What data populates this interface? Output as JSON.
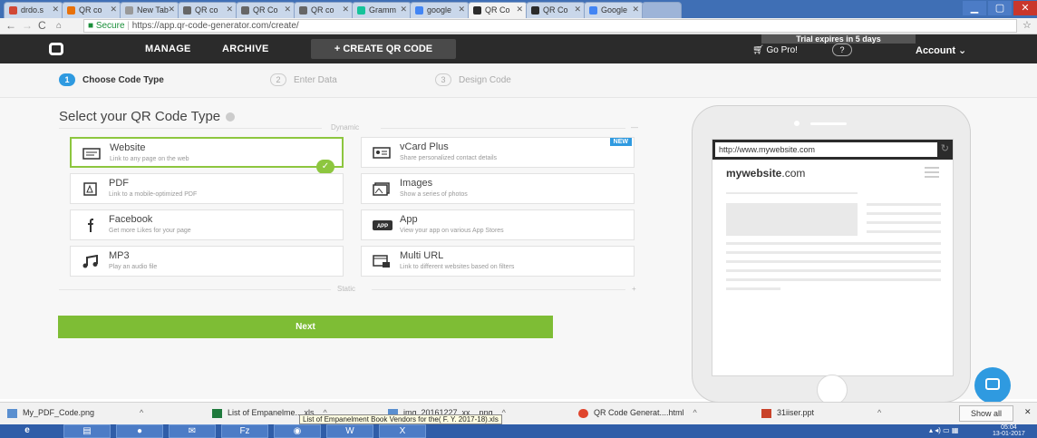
{
  "browser": {
    "tabs": [
      {
        "label": "drdo.s",
        "color": "#d14836"
      },
      {
        "label": "QR co",
        "color": "#e8710a"
      },
      {
        "label": "New Tab",
        "color": "#999999"
      },
      {
        "label": "QR co",
        "color": "#666666"
      },
      {
        "label": "QR Co",
        "color": "#666666"
      },
      {
        "label": "QR co",
        "color": "#666666"
      },
      {
        "label": "Gramm",
        "color": "#15c39a"
      },
      {
        "label": "google",
        "color": "#4285f4"
      },
      {
        "label": "QR Co",
        "color": "#2b2b2b",
        "active": true
      },
      {
        "label": "QR Co",
        "color": "#2b2b2b"
      },
      {
        "label": "Google",
        "color": "#4285f4"
      }
    ],
    "url_secure": "Secure",
    "url": "https://app.qr-code-generator.com/create/"
  },
  "header": {
    "manage": "MANAGE",
    "archive": "ARCHIVE",
    "create": "+ CREATE QR CODE",
    "trial": "Trial expires in 5 days",
    "gopro": "Go Pro!",
    "help": "?",
    "account": "Account ⌄"
  },
  "steps": [
    {
      "num": "1",
      "label": "Choose Code Type"
    },
    {
      "num": "2",
      "label": "Enter Data"
    },
    {
      "num": "3",
      "label": "Design Code"
    }
  ],
  "main": {
    "heading": "Select your QR Code Type",
    "dynamic_label": "Dynamic",
    "static_label": "Static",
    "dynamic_toggle": "—",
    "static_toggle": "+",
    "next": "Next"
  },
  "cards": [
    {
      "title": "Website",
      "sub": "Link to any page on the web",
      "icon": "website-icon"
    },
    {
      "title": "vCard Plus",
      "sub": "Share personalized contact details",
      "icon": "vcard-icon",
      "badge": "NEW"
    },
    {
      "title": "PDF",
      "sub": "Link to a mobile-optimized PDF",
      "icon": "pdf-icon"
    },
    {
      "title": "Images",
      "sub": "Show a series of photos",
      "icon": "images-icon"
    },
    {
      "title": "Facebook",
      "sub": "Get more Likes for your page",
      "icon": "facebook-icon"
    },
    {
      "title": "App",
      "sub": "View your app on various App Stores",
      "icon": "app-icon",
      "icon_text": "APP"
    },
    {
      "title": "MP3",
      "sub": "Play an audio file",
      "icon": "music-icon"
    },
    {
      "title": "Multi URL",
      "sub": "Link to different websites based on filters",
      "icon": "multi-url-icon"
    }
  ],
  "preview": {
    "url": "http://www.mywebsite.com",
    "site_bold": "mywebsite",
    "site_rest": ".com"
  },
  "downloads": {
    "items": [
      {
        "label": "My_PDF_Code.png"
      },
      {
        "label": "List of Empanelme....xls"
      },
      {
        "label": "img_20161227_xx....png"
      },
      {
        "label": "QR Code Generat....html"
      },
      {
        "label": "31iiser.ppt"
      }
    ],
    "tooltip": "List of Empanelment Book Vendors for the( F. Y. 2017-18).xls",
    "show_all": "Show all"
  },
  "taskbar": {
    "time": "05:04",
    "date": "13-01-2017"
  },
  "colors": {
    "accent_green": "#7ebd35",
    "accent_blue": "#2f9ae0",
    "header_dark": "#2b2b2b"
  }
}
